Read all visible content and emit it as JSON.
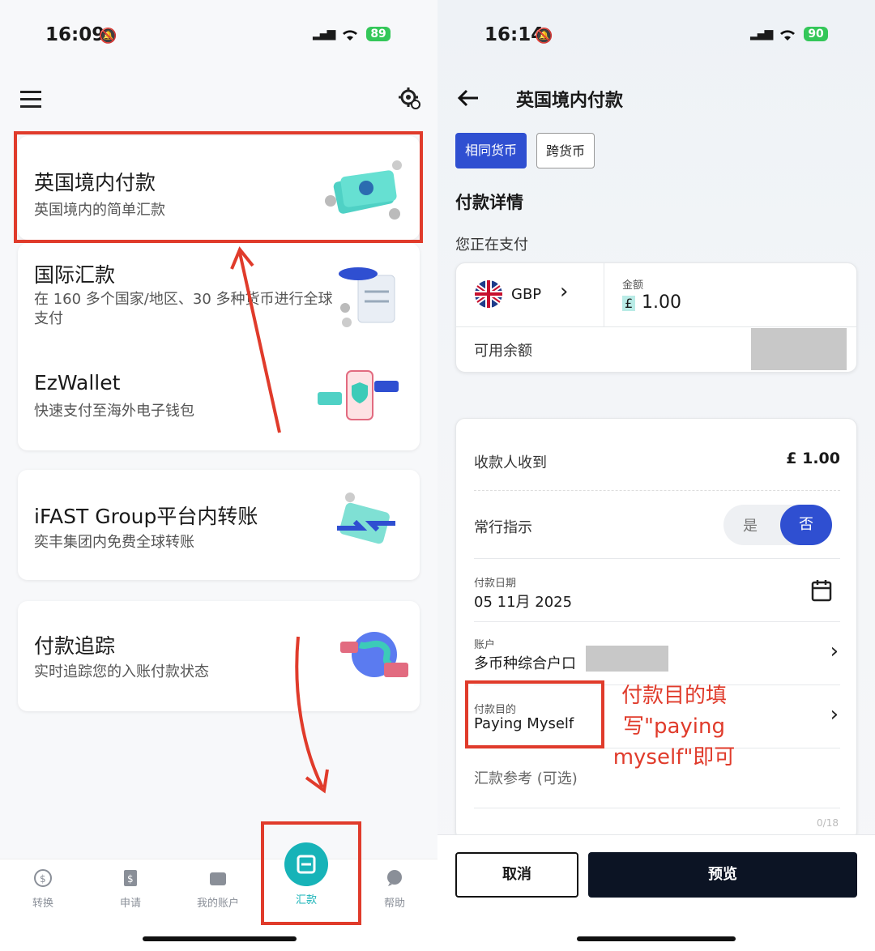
{
  "left": {
    "status": {
      "time": "16:09",
      "battery": "89"
    },
    "services": [
      {
        "title": "英国境内付款",
        "subtitle": "英国境内的简单汇款"
      },
      {
        "title": "国际汇款",
        "subtitle": "在 160 多个国家/地区、30 多种货币进行全球支付"
      },
      {
        "title": "EzWallet",
        "subtitle": "快速支付至海外电子钱包"
      },
      {
        "title": "iFAST Group平台内转账",
        "subtitle": "奕丰集团内免费全球转账"
      },
      {
        "title": "付款追踪",
        "subtitle": "实时追踪您的入账付款状态"
      }
    ],
    "tabs": [
      {
        "label": "转换"
      },
      {
        "label": "申请"
      },
      {
        "label": "我的账户"
      },
      {
        "label": "汇款"
      },
      {
        "label": "帮助"
      }
    ]
  },
  "right": {
    "status": {
      "time": "16:14",
      "battery": "90"
    },
    "header": {
      "title": "英国境内付款"
    },
    "segments": {
      "same": "相同货币",
      "cross": "跨货币"
    },
    "section_title": "付款详情",
    "paying_label": "您正在支付",
    "currency": {
      "code": "GBP",
      "amount_label": "金额",
      "symbol": "£",
      "amount": "1.00"
    },
    "balance_label": "可用余额",
    "receive": {
      "label": "收款人收到",
      "value": "£ 1.00"
    },
    "standing": {
      "label": "常行指示",
      "yes": "是",
      "no": "否"
    },
    "date": {
      "label": "付款日期",
      "value": "05 11月 2025"
    },
    "account": {
      "label": "账户",
      "value": "多币种综合户口"
    },
    "purpose": {
      "label": "付款目的",
      "value": "Paying Myself"
    },
    "reference": {
      "label": "汇款参考 (可选)",
      "counter": "0/18"
    },
    "annotation": "付款目的填写\"paying myself\"即可",
    "buttons": {
      "cancel": "取消",
      "preview": "预览"
    }
  },
  "colors": {
    "accent": "#2f4fd1",
    "teal": "#17b3b8",
    "annotation_red": "#e03b2b",
    "dark_button": "#0c1424"
  }
}
